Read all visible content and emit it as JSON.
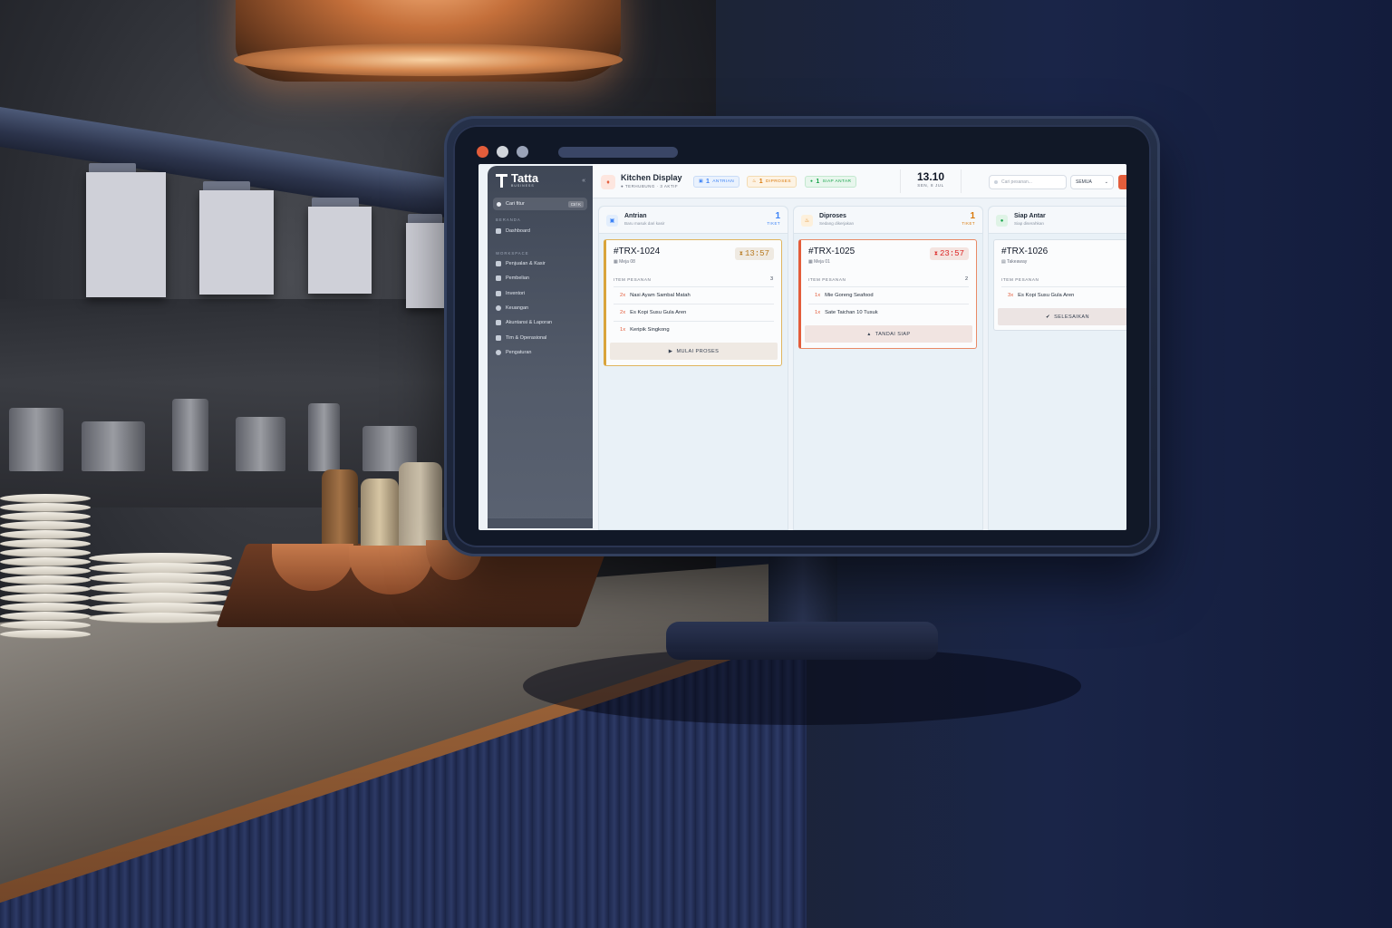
{
  "sidebar": {
    "brand": "Tatta",
    "brand_sub": "BUSINESS",
    "collapse_icon": "«",
    "search_label": "Cari fitur",
    "search_shortcut": "Ctrl K",
    "section_home": "BERANDA",
    "section_workspace": "WORKSPACE",
    "dashboard": "Dashboard",
    "items": [
      {
        "label": "Penjualan & Kasir",
        "icon": "cart-icon"
      },
      {
        "label": "Pembelian",
        "icon": "bag-icon"
      },
      {
        "label": "Inventori",
        "icon": "box-icon"
      },
      {
        "label": "Keuangan",
        "icon": "coin-icon"
      },
      {
        "label": "Akuntansi & Laporan",
        "icon": "report-icon"
      },
      {
        "label": "Tim & Operasional",
        "icon": "team-icon"
      },
      {
        "label": "Pengaturan",
        "icon": "gear-icon"
      }
    ]
  },
  "header": {
    "title": "Kitchen Display",
    "status": "● TERHUBUNG · 3 AKTIF",
    "pills": [
      {
        "count": "1",
        "label": "ANTRIAN",
        "color": "#3b82f6"
      },
      {
        "count": "1",
        "label": "DIPROSES",
        "color": "#d97706"
      },
      {
        "count": "1",
        "label": "SIAP ANTAR",
        "color": "#16a34a"
      }
    ],
    "time": "13.10",
    "date": "SEN, 8 JUL",
    "search_placeholder": "Cari pesanan...",
    "filter": "SEMUA",
    "filter_chevron": "⌄"
  },
  "columns": [
    {
      "title": "Antrian",
      "subtitle": "Baru masuk dari kasir",
      "count": "1",
      "count_label": "TIKET",
      "accent": "#3b82f6",
      "ticket": {
        "id": "#TRX-1024",
        "location": "Meja 08",
        "timer": "13:57",
        "items_label": "ITEM PESANAN",
        "items_count": "3",
        "items": [
          {
            "qty": "2x",
            "name": "Nasi Ayam Sambal Matah"
          },
          {
            "qty": "2x",
            "name": "Es Kopi Susu Gula Aren"
          },
          {
            "qty": "1x",
            "name": "Keripik Singkong"
          }
        ],
        "action": "MULAI PROSES",
        "action_icon": "▶"
      }
    },
    {
      "title": "Diproses",
      "subtitle": "Sedang dikerjakan",
      "count": "1",
      "count_label": "TIKET",
      "accent": "#d97706",
      "ticket": {
        "id": "#TRX-1025",
        "location": "Meja 01",
        "timer": "23:57",
        "items_label": "ITEM PESANAN",
        "items_count": "2",
        "items": [
          {
            "qty": "1x",
            "name": "Mie Goreng Seafood"
          },
          {
            "qty": "1x",
            "name": "Sate Taichan 10 Tusuk"
          }
        ],
        "action": "TANDAI SIAP",
        "action_icon": "🔔"
      }
    },
    {
      "title": "Siap Antar",
      "subtitle": "Siap diserahkan",
      "count": "",
      "count_label": "",
      "accent": "#16a34a",
      "ticket": {
        "id": "#TRX-1026",
        "location": "Takeaway",
        "items_label": "ITEM PESANAN",
        "items": [
          {
            "qty": "3x",
            "name": "Es Kopi Susu Gula Aren"
          }
        ],
        "action": "SELESAIKAN",
        "action_icon": "✔"
      }
    }
  ],
  "colors": {
    "accent": "#e35d3b",
    "queue": "#3b82f6",
    "process": "#d97706",
    "ready": "#16a34a"
  }
}
